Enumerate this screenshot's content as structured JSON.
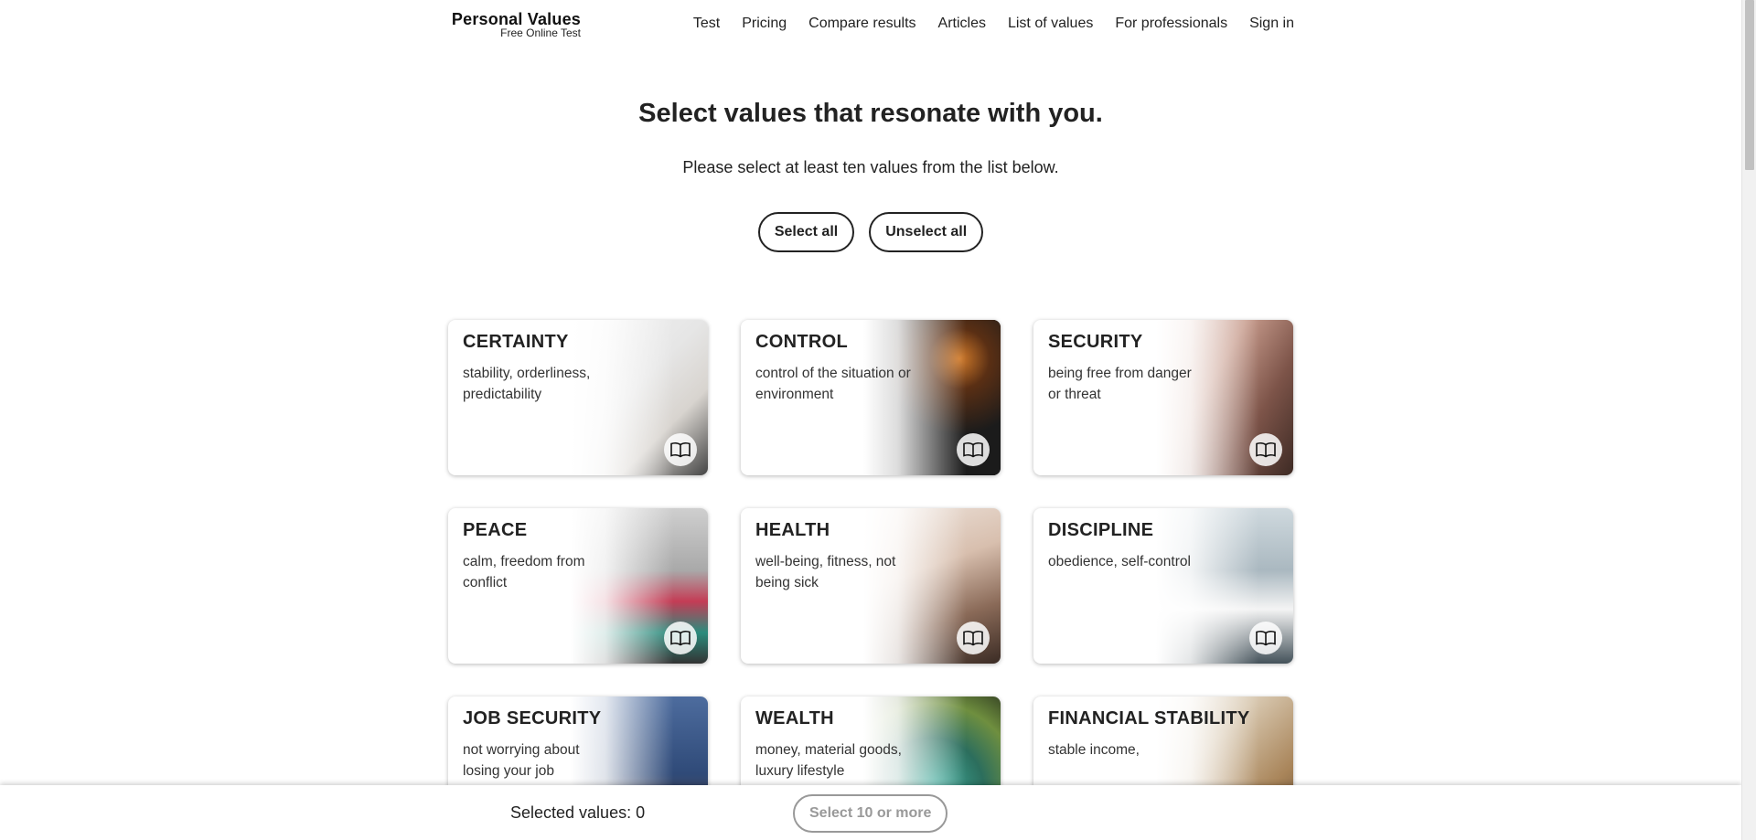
{
  "header": {
    "logo_title": "Personal Values",
    "logo_subtitle": "Free Online Test",
    "nav": [
      "Test",
      "Pricing",
      "Compare results",
      "Articles",
      "List of values",
      "For professionals",
      "Sign in"
    ]
  },
  "intro": {
    "title": "Select values that resonate with you.",
    "subtitle": "Please select at least ten values from the list below.",
    "select_all": "Select all",
    "unselect_all": "Unselect all"
  },
  "cards": [
    {
      "title": "CERTAINTY",
      "desc": "stability, orderliness, predictability",
      "image": "img-certainty"
    },
    {
      "title": "CONTROL",
      "desc": "control of the situation or environment",
      "image": "img-control"
    },
    {
      "title": "SECURITY",
      "desc": "being free from danger or threat",
      "image": "img-security"
    },
    {
      "title": "PEACE",
      "desc": "calm, freedom from conflict",
      "image": "img-peace"
    },
    {
      "title": "HEALTH",
      "desc": "well-being, fitness, not being sick",
      "image": "img-health"
    },
    {
      "title": "DISCIPLINE",
      "desc": "obedience, self-control",
      "image": "img-discipline"
    },
    {
      "title": "JOB SECURITY",
      "desc": "not worrying about losing your job",
      "image": "img-jobsecurity"
    },
    {
      "title": "WEALTH",
      "desc": "money, material goods, luxury lifestyle",
      "image": "img-wealth"
    },
    {
      "title": "FINANCIAL STABILITY",
      "desc": "stable income,",
      "image": "img-financial"
    }
  ],
  "card_icon": "book-icon",
  "bottom_bar": {
    "selected_label": "Selected values: 0",
    "next_button": "Select 10 or more"
  }
}
